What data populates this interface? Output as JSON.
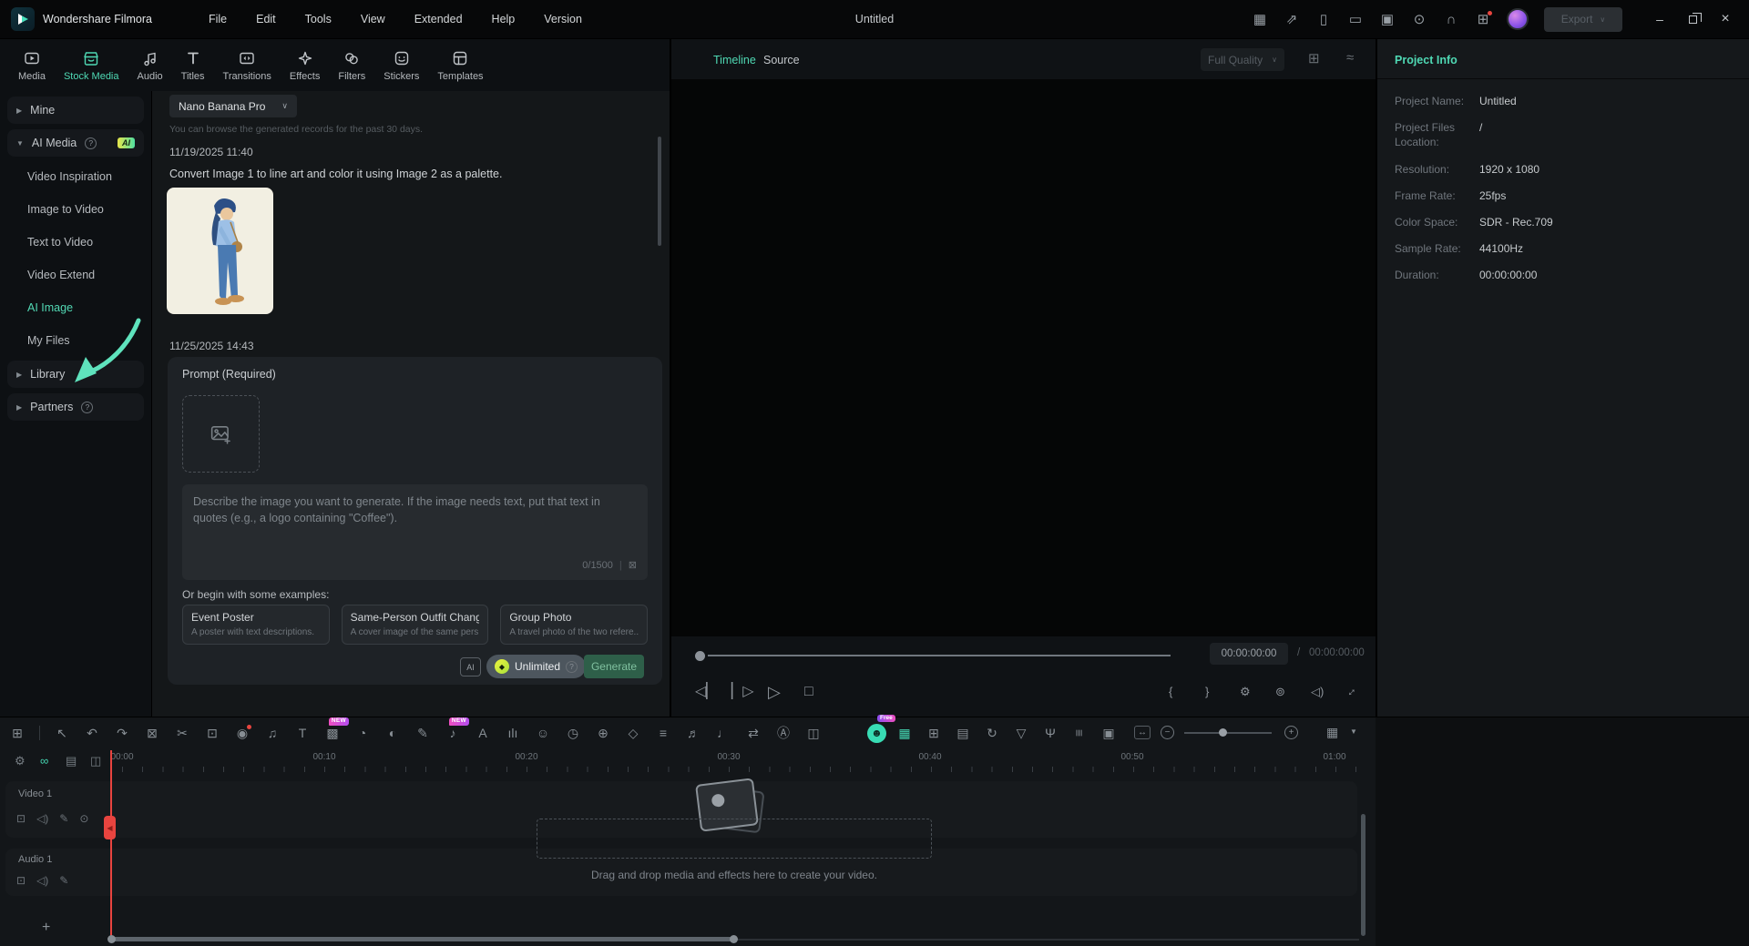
{
  "titlebar": {
    "app_name": "Wondershare Filmora",
    "menus": [
      "File",
      "Edit",
      "Tools",
      "View",
      "Extended",
      "Help",
      "Version"
    ],
    "document_title": "Untitled",
    "export_label": "Export",
    "icons": [
      {
        "name": "gift-icon",
        "glyph": "▦"
      },
      {
        "name": "send-feedback-icon",
        "glyph": "⇗"
      },
      {
        "name": "mobile-transfer-icon",
        "glyph": "▯"
      },
      {
        "name": "workspace-layout-icon",
        "glyph": "▭"
      },
      {
        "name": "save-project-icon",
        "glyph": "▣"
      },
      {
        "name": "upload-icon",
        "glyph": "⊙"
      },
      {
        "name": "support-headset-icon",
        "glyph": "∩"
      },
      {
        "name": "apps-grid-icon",
        "glyph": "⊞",
        "badge": "",
        "badgeClass": "dot-badge"
      }
    ]
  },
  "media_tabs": [
    "Media",
    "Stock Media",
    "Audio",
    "Titles",
    "Transitions",
    "Effects",
    "Filters",
    "Stickers",
    "Templates"
  ],
  "sidebar": {
    "mine": "Mine",
    "ai_media": "AI Media",
    "ai_badge": "AI",
    "video_inspiration": "Video Inspiration",
    "image_to_video": "Image to Video",
    "text_to_video": "Text to Video",
    "video_extend": "Video Extend",
    "ai_image": "AI Image",
    "my_files": "My Files",
    "library": "Library",
    "partners": "Partners"
  },
  "generator": {
    "model": "Nano Banana Pro",
    "notice": "You can browse the generated records for the past 30 days.",
    "history": {
      "date": "11/19/2025 11:40",
      "prompt": "Convert Image 1 to line art and color it using Image 2 as a palette."
    },
    "session_date": "11/25/2025 14:43",
    "prompt_label": "Prompt (Required)",
    "placeholder": "Describe the image you want to generate. If the image needs text, put that text in quotes (e.g., a logo containing \"Coffee\").",
    "char_counter": "0/1500",
    "examples_label": "Or begin with some examples:",
    "examples": [
      {
        "title": "Event Poster",
        "desc": "A poster with text descriptions."
      },
      {
        "title": "Same-Person Outfit Change",
        "desc": "A cover image of the same pers..."
      },
      {
        "title": "Group Photo",
        "desc": "A travel photo of the two refere..."
      }
    ],
    "credits_label": "Unlimited",
    "generate_label": "Generate"
  },
  "preview": {
    "tab_timeline": "Timeline",
    "tab_source": "Source",
    "quality": "Full Quality",
    "current_time": "00:00:00:00",
    "total_time": "00:00:00:00"
  },
  "project_info": {
    "title": "Project Info",
    "rows": [
      {
        "label": "Project Name:",
        "value": "Untitled"
      },
      {
        "label": "Project Files Location:",
        "value": "/"
      },
      {
        "label": "Resolution:",
        "value": "1920 x 1080"
      },
      {
        "label": "Frame Rate:",
        "value": "25fps"
      },
      {
        "label": "Color Space:",
        "value": "SDR - Rec.709"
      },
      {
        "label": "Sample Rate:",
        "value": "44100Hz"
      },
      {
        "label": "Duration:",
        "value": "00:00:00:00"
      }
    ]
  },
  "timeline": {
    "toolbar_left": [
      {
        "name": "select-tool-icon",
        "glyph": "↖"
      },
      {
        "name": "undo-icon",
        "glyph": "↶"
      },
      {
        "name": "redo-icon",
        "glyph": "↷"
      },
      {
        "name": "delete-icon",
        "glyph": "⊠"
      },
      {
        "name": "split-scissors-icon",
        "glyph": "✂"
      },
      {
        "name": "crop-icon",
        "glyph": "⊡"
      },
      {
        "name": "record-icon",
        "glyph": "◉",
        "badge": "",
        "badgeClass": "dot-badge"
      },
      {
        "name": "beat-detection-icon",
        "glyph": "♫"
      },
      {
        "name": "text-tool-icon",
        "glyph": "T"
      },
      {
        "name": "mask-icon",
        "glyph": "▩",
        "badge": "NEW",
        "badgeClass": "new-badge"
      },
      {
        "name": "speed-icon",
        "glyph": "◔"
      },
      {
        "name": "ai-color-palette-icon",
        "glyph": "◐"
      },
      {
        "name": "text-preset-icon",
        "glyph": "✎"
      },
      {
        "name": "ai-audio-icon",
        "glyph": "♪",
        "badge": "NEW",
        "badgeClass": "new-badge"
      },
      {
        "name": "ai-text-icon",
        "glyph": "A"
      },
      {
        "name": "voice-changer-icon",
        "glyph": "ılı"
      },
      {
        "name": "ai-portrait-icon",
        "glyph": "☺"
      },
      {
        "name": "duration-icon",
        "glyph": "◷"
      },
      {
        "name": "add-keyframe-icon",
        "glyph": "⊕"
      },
      {
        "name": "keyframe-diamond-icon",
        "glyph": "◇"
      },
      {
        "name": "adjustment-icon",
        "glyph": "≡"
      },
      {
        "name": "audio-visualizer-icon",
        "glyph": "♬"
      },
      {
        "name": "text-to-speech-icon",
        "glyph": "♩"
      },
      {
        "name": "speech-to-text-icon",
        "glyph": "⇄"
      },
      {
        "name": "auto-caption-icon",
        "glyph": "Ⓐ"
      },
      {
        "name": "audio-ducking-icon",
        "glyph": "◫"
      }
    ],
    "toolbar_ai": [
      {
        "name": "ai-copilot-icon",
        "glyph": "☻",
        "cls": "copilot",
        "badge": "Free",
        "badgeClass": "free-badge"
      },
      {
        "name": "smart-short-clips-icon",
        "glyph": "▦",
        "cls": "teal"
      },
      {
        "name": "text-based-editing-icon",
        "glyph": "⊞"
      },
      {
        "name": "scene-detection-icon",
        "glyph": "▤"
      },
      {
        "name": "render-preview-icon",
        "glyph": "↻"
      },
      {
        "name": "safe-area-icon",
        "glyph": "▽"
      },
      {
        "name": "voiceover-record-icon",
        "glyph": "Ψ"
      },
      {
        "name": "audio-mixer-icon",
        "glyph": "≡",
        "cls": "rot90"
      },
      {
        "name": "screen-recorder-icon",
        "glyph": "▣"
      }
    ],
    "ruler": [
      "00:00",
      "00:10",
      "00:20",
      "00:30",
      "00:40",
      "00:50",
      "01:00"
    ],
    "video_track": "Video 1",
    "audio_track": "Audio 1",
    "drop_hint": "Drag and drop media and effects here to create your video."
  }
}
